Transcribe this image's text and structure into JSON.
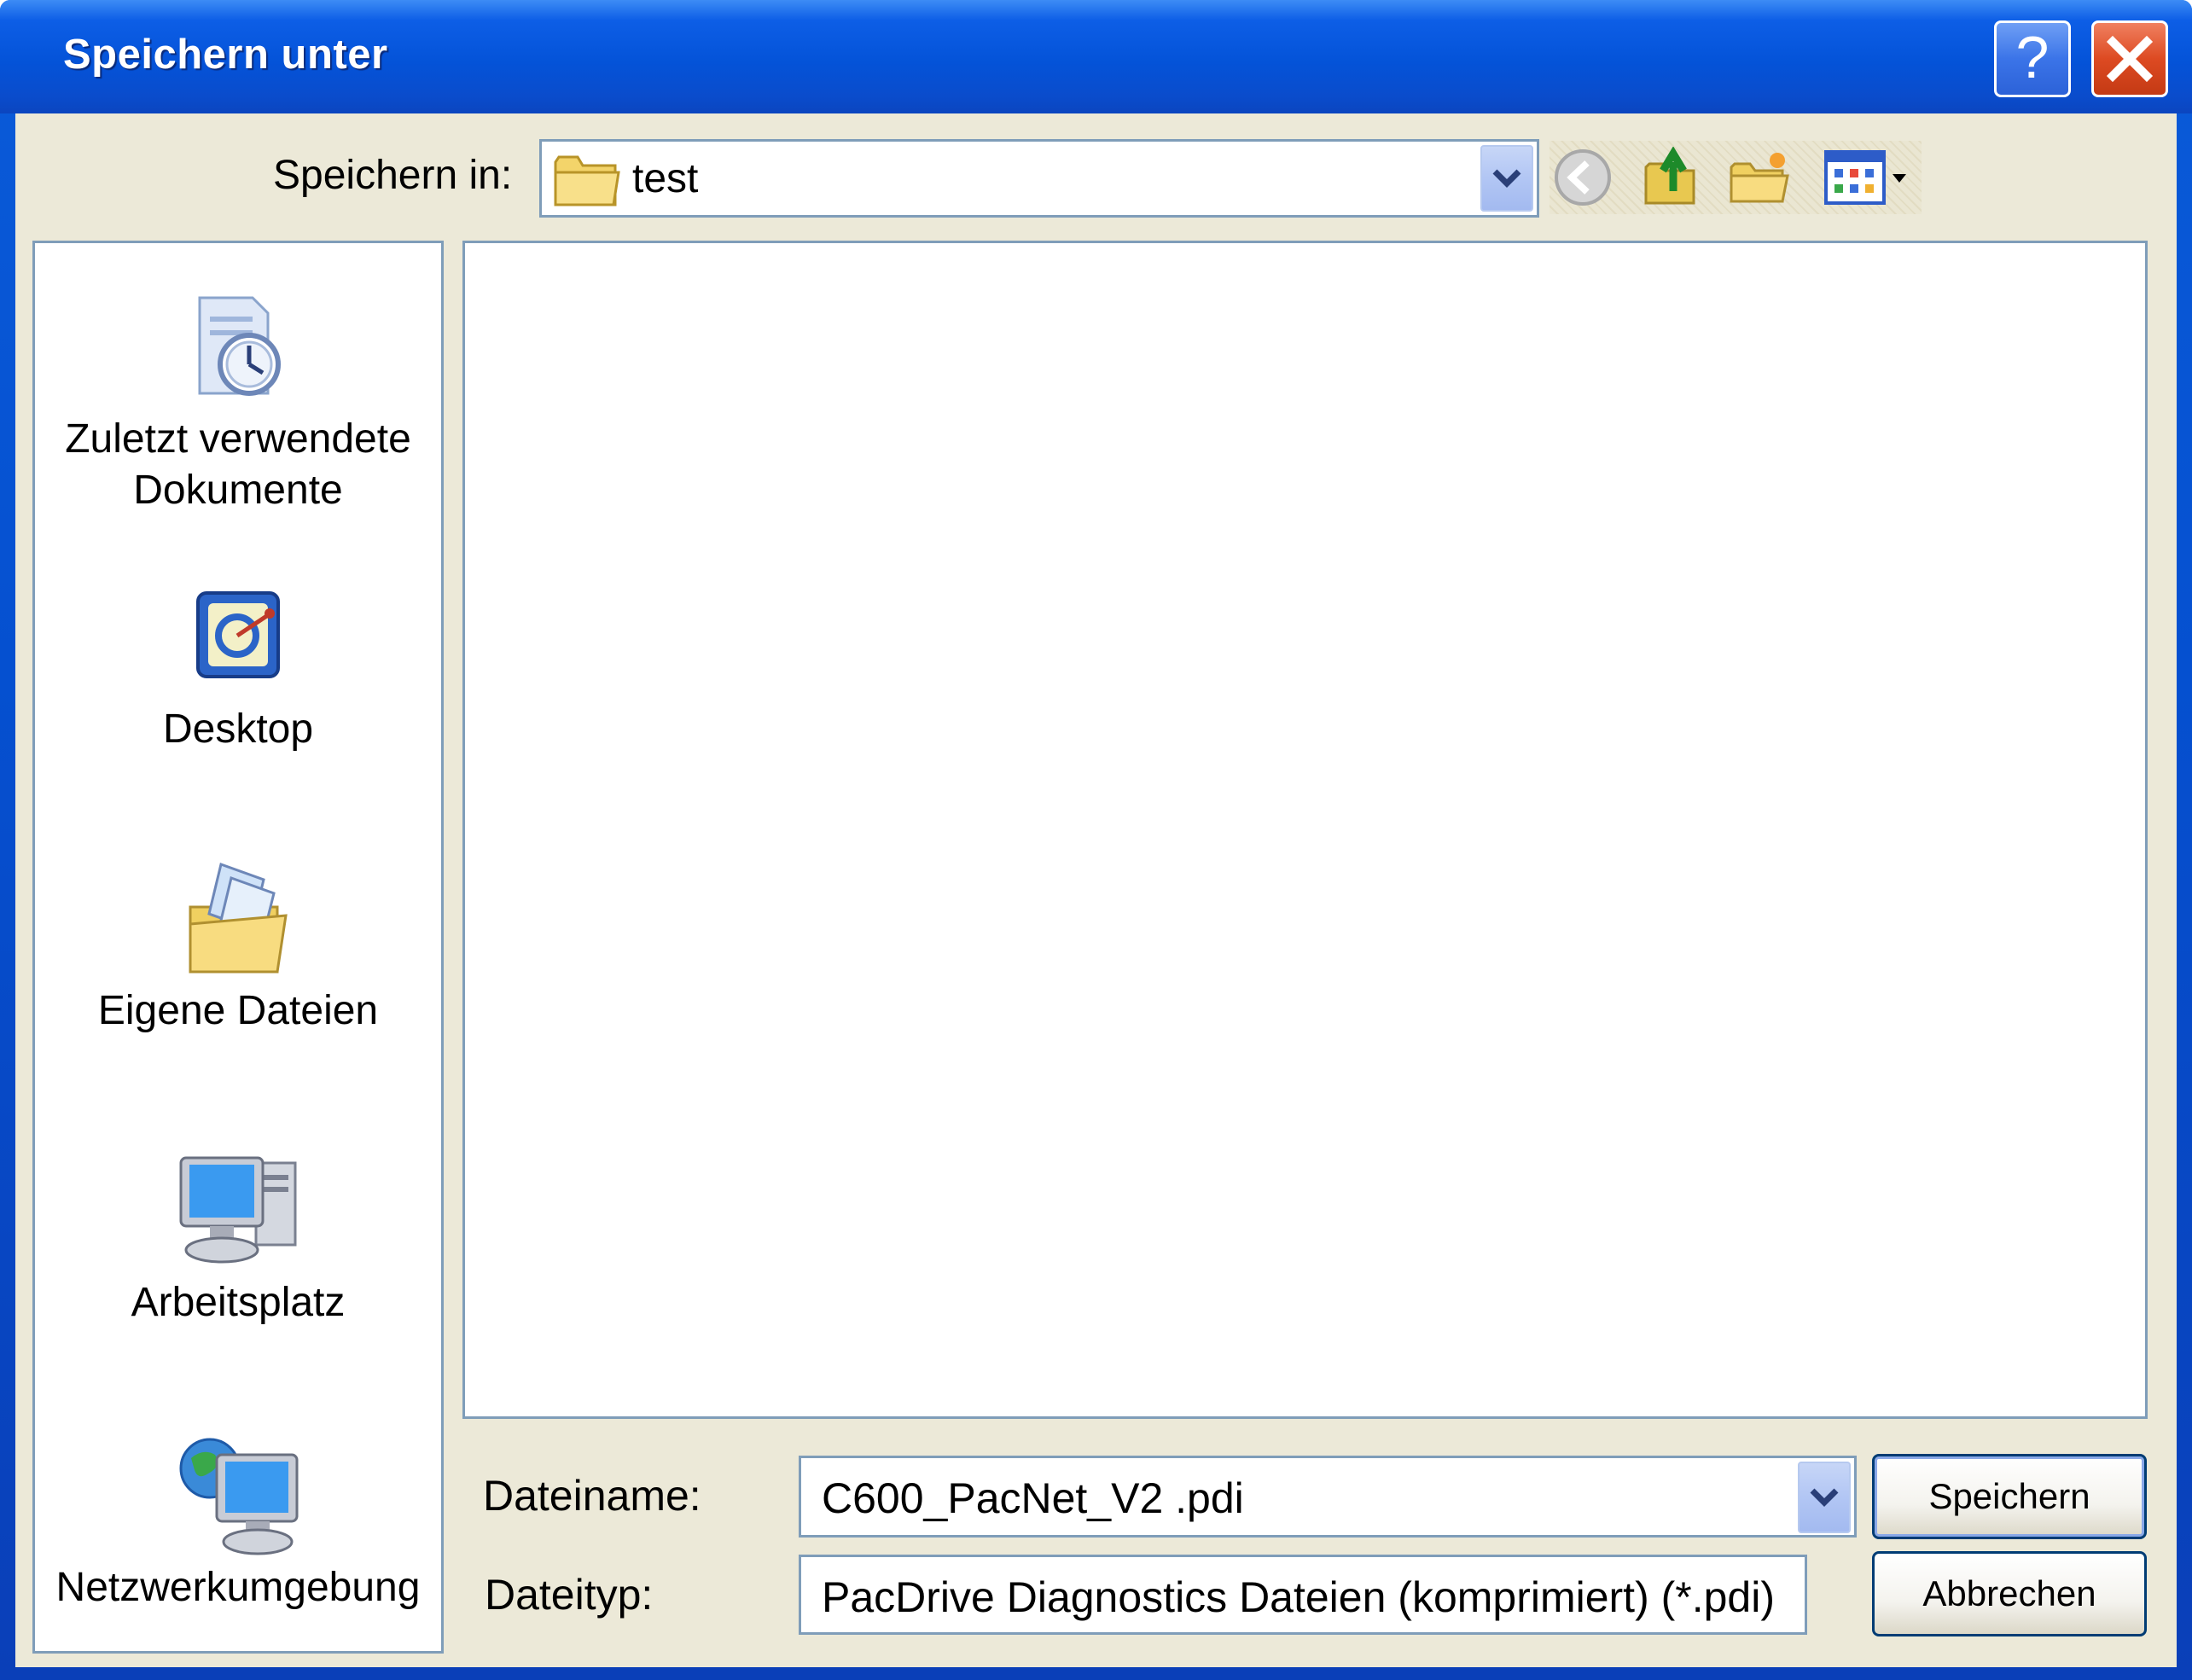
{
  "window": {
    "title": "Speichern unter",
    "help_label": "?",
    "close_label": "✕"
  },
  "lookin": {
    "label": "Speichern in:",
    "value": "test"
  },
  "places": [
    {
      "label_line1": "Zuletzt verwendete",
      "label_line2": "Dokumente",
      "icon": "recent-documents-icon"
    },
    {
      "label_line1": "Desktop",
      "label_line2": "",
      "icon": "desktop-icon"
    },
    {
      "label_line1": "Eigene Dateien",
      "label_line2": "",
      "icon": "my-documents-icon"
    },
    {
      "label_line1": "Arbeitsplatz",
      "label_line2": "",
      "icon": "my-computer-icon"
    },
    {
      "label_line1": "Netzwerkumgebung",
      "label_line2": "",
      "icon": "network-places-icon"
    }
  ],
  "filename": {
    "label": "Dateiname:",
    "value": "C600_PacNet_V2 .pdi"
  },
  "filetype": {
    "label": "Dateityp:",
    "value": "PacDrive Diagnostics Dateien (komprimiert) (*.pdi)"
  },
  "buttons": {
    "save": "Speichern",
    "cancel": "Abbrechen"
  },
  "colors": {
    "titlebar": "#0453d8",
    "client": "#ece9d8",
    "border": "#7f9db9"
  }
}
